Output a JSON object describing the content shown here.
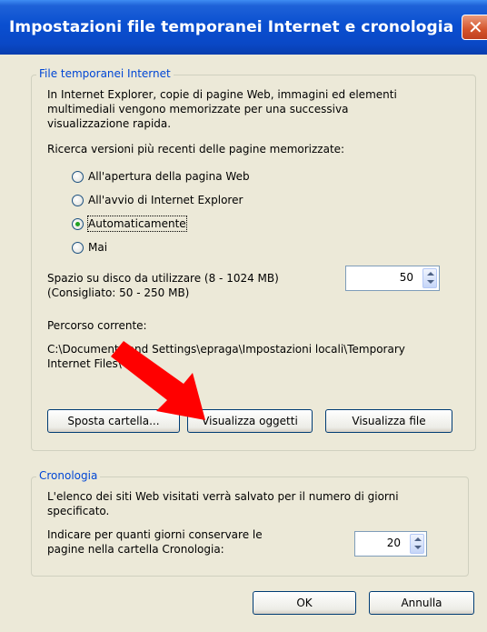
{
  "window": {
    "title": "Impostazioni file temporanei Internet e cronologia",
    "close_glyph": "✕"
  },
  "temp_files": {
    "legend": "File temporanei Internet",
    "description": [
      "In Internet Explorer, copie di pagine Web, immagini ed elementi",
      "multimediali vengono memorizzate per una successiva",
      "visualizzazione rapida."
    ],
    "check_label": "Ricerca versioni più recenti delle pagine memorizzate:",
    "options": [
      {
        "label": "All'apertura della pagina Web",
        "checked": false
      },
      {
        "label": "All'avvio di Internet Explorer",
        "checked": false
      },
      {
        "label": "Automaticamente",
        "checked": true
      },
      {
        "label": "Mai",
        "checked": false
      }
    ],
    "disk_space_label": [
      "Spazio su disco da utilizzare (8 - 1024 MB)",
      "(Consigliato: 50 - 250 MB)"
    ],
    "disk_space_value": "50",
    "current_path_label": "Percorso corrente:",
    "current_path": [
      "C:\\Documents and Settings\\epraga\\Impostazioni locali\\Temporary",
      "Internet Files\\"
    ],
    "buttons": {
      "move_folder": "Sposta cartella...",
      "view_objects": "Visualizza oggetti",
      "view_files": "Visualizza file"
    }
  },
  "history": {
    "legend": "Cronologia",
    "description": [
      "L'elenco dei siti Web visitati verrà salvato per il numero di giorni",
      "specificato."
    ],
    "days_label": [
      "Indicare per quanti giorni conservare le",
      "pagine nella cartella Cronologia:"
    ],
    "days_value": "20"
  },
  "footer": {
    "ok": "OK",
    "cancel": "Annulla"
  },
  "colors": {
    "title_bar": "#0a4fd0",
    "legend_text": "#0046d5",
    "annotation_arrow": "#ff0000"
  },
  "icons": {
    "close": "close-icon",
    "spin_up": "chevron-up-icon",
    "spin_down": "chevron-down-icon",
    "annotation": "red-arrow-icon"
  }
}
